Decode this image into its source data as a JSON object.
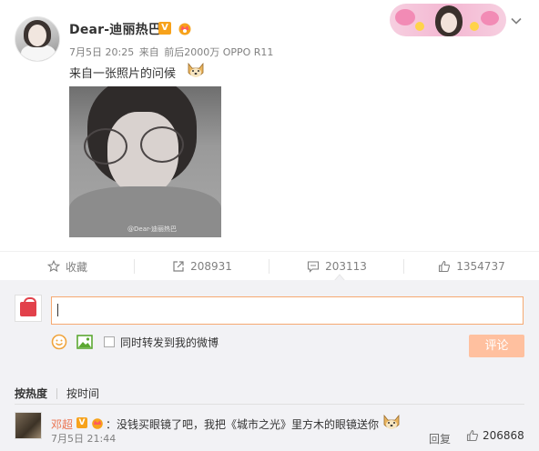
{
  "post": {
    "username": "Dear-迪丽热巴",
    "vip_badge": "V",
    "time": "7月5日 20:25",
    "source_prefix": "来自",
    "source_label": "前后2000万 OPPO R11",
    "text": "来自一张照片的问候",
    "photo_watermark": "@Dear-迪丽热巴"
  },
  "actions": {
    "favorite_label": "收藏",
    "repost_count": "208931",
    "comment_count": "203113",
    "like_count": "1354737"
  },
  "comment_box": {
    "value": "",
    "placeholder": "",
    "sync_label": "同时转发到我的微博",
    "submit_label": "评论"
  },
  "sort": {
    "by_hot": "按热度",
    "by_time": "按时间"
  },
  "comments": [
    {
      "name": "邓超",
      "vip_badge": "V",
      "text": "：没钱买眼镜了吧，我把《城市之光》里方木的眼镜送你",
      "time": "7月5日 21:44",
      "reply_label": "回复",
      "like_count": "206868"
    }
  ],
  "colors": {
    "accent_orange": "#eb7350",
    "submit_disabled": "#ffc09f",
    "vip_gold": "#f7a21b"
  }
}
